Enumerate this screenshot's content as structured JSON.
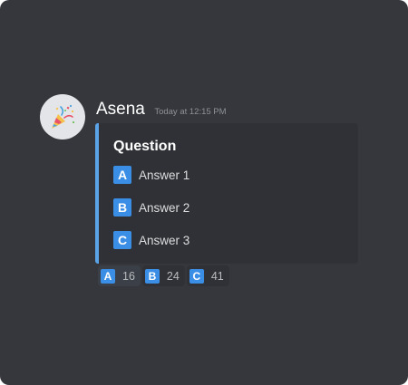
{
  "message": {
    "author": "Asena",
    "timestamp": "Today at 12:15 PM",
    "avatar_icon": "party-popper-icon",
    "embed": {
      "title": "Question",
      "accent_color": "#5aa3e6",
      "options": [
        {
          "letter": "A",
          "text": "Answer 1"
        },
        {
          "letter": "B",
          "text": "Answer 2"
        },
        {
          "letter": "C",
          "text": "Answer 3"
        }
      ]
    },
    "reactions": [
      {
        "letter": "A",
        "count": "16"
      },
      {
        "letter": "B",
        "count": "24"
      },
      {
        "letter": "C",
        "count": "41"
      }
    ]
  },
  "colors": {
    "background": "#35373c",
    "badge": "#3a8ee6"
  }
}
